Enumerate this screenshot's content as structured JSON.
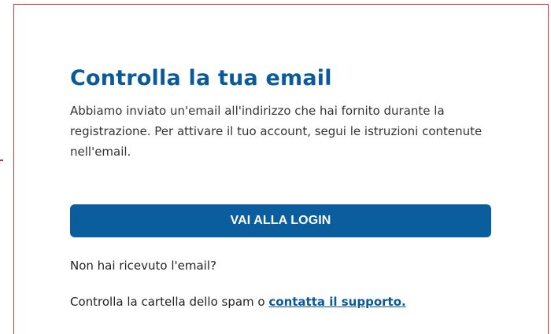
{
  "dialog": {
    "title": "Controlla la tua email",
    "description": "Abbiamo inviato un'email all'indirizzo che hai fornito durante la registrazione. Per attivare il tuo account, segui le istruzioni contenute nell'email.",
    "login_button_label": "VAI ALLA LOGIN",
    "not_received_text": "Non hai ricevuto l'email?",
    "spam_prefix": "Controlla la cartella dello spam o ",
    "support_link_label": "contatta il supporto."
  },
  "colors": {
    "brand_blue": "#0a5e9e",
    "title_blue": "#0a5a9a",
    "card_border": "#d9363e",
    "text": "#333333"
  }
}
